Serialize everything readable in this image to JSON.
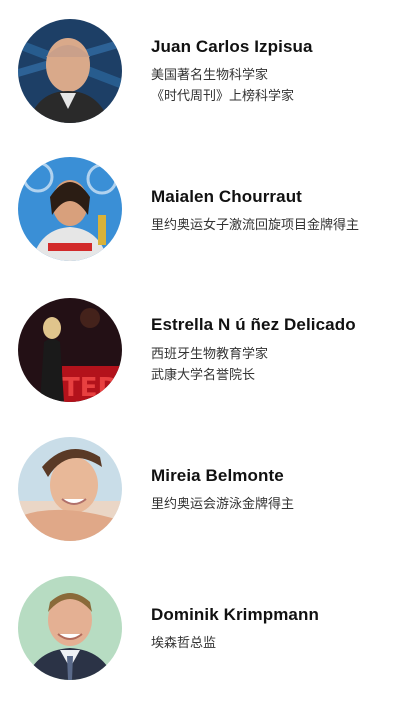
{
  "people": [
    {
      "name": "Juan Carlos Izpisua",
      "lines": [
        "美国著名生物科学家",
        "《时代周刊》上榜科学家"
      ]
    },
    {
      "name": "Maialen Chourraut",
      "lines": [
        "里约奥运女子激流回旋项目金牌得主"
      ]
    },
    {
      "name": "Estrella N ú ñez Delicado",
      "lines": [
        "西班牙生物教育学家",
        "武康大学名誉院长"
      ]
    },
    {
      "name": "Mireia Belmonte",
      "lines": [
        "里约奥运会游泳金牌得主"
      ]
    },
    {
      "name": "Dominik Krimpmann",
      "lines": [
        "埃森哲总监"
      ]
    }
  ]
}
